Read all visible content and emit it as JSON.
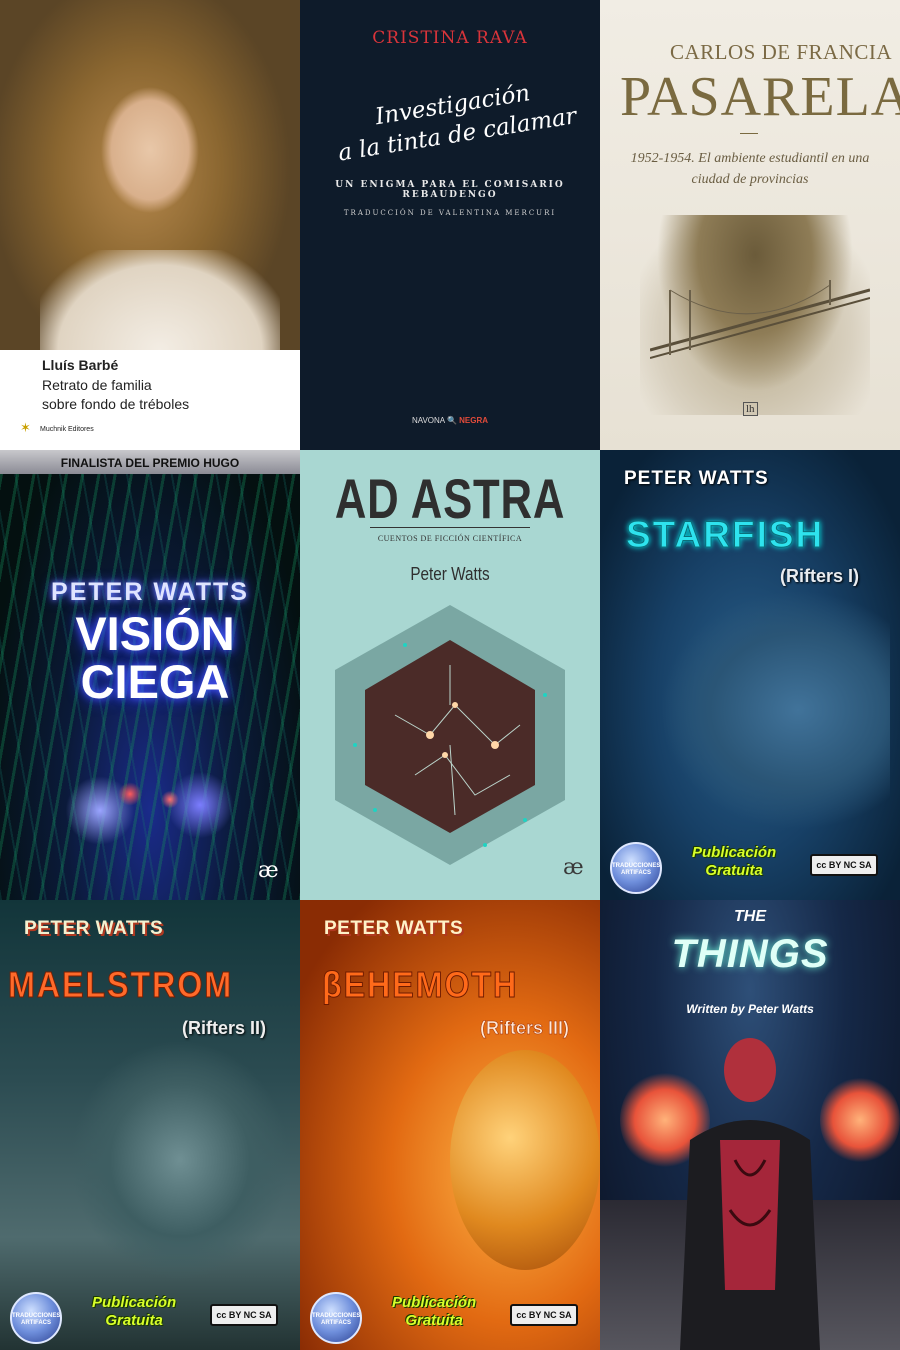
{
  "covers": [
    {
      "author": "Lluís Barbé",
      "title_line1": "Retrato de familia",
      "title_line2": "sobre fondo de tréboles",
      "publisher": "Muchnik Editores"
    },
    {
      "author": "CRISTINA RAVA",
      "title_line1": "Investigación",
      "title_line2": "a la tinta de calamar",
      "subtitle": "UN ENIGMA PARA EL COMISARIO REBAUDENGO",
      "translator": "TRADUCCIÓN DE VALENTINA MERCURI",
      "publisher_a": "NAVONA",
      "publisher_b": "NEGRA"
    },
    {
      "author": "CARLOS DE FRANCIA",
      "title": "PASARELA",
      "subtitle": "1952-1954. El ambiente estudiantil en una ciudad de provincias",
      "publisher": "lh"
    },
    {
      "banner": "FINALISTA DEL PREMIO HUGO",
      "author": "PETER WATTS",
      "title_line1": "VISIÓN",
      "title_line2": "CIEGA"
    },
    {
      "title": "AD ASTRA",
      "subtitle": "CUENTOS DE FICCIÓN CIENTÍFICA",
      "author": "Peter Watts"
    },
    {
      "author": "PETER WATTS",
      "title": "STARFISH",
      "series": "(Rifters I)",
      "badge_line1": "Publicación",
      "badge_line2": "Gratuita"
    },
    {
      "author": "PETER WATTS",
      "title": "MAELSTROM",
      "series": "(Rifters II)",
      "badge_line1": "Publicación",
      "badge_line2": "Gratuita"
    },
    {
      "author": "PETER WATTS",
      "title": "βEHEMOTH",
      "series": "(Rifters III)",
      "badge_line1": "Publicación",
      "badge_line2": "Gratuita"
    },
    {
      "title_the": "THE",
      "title": "THINGS",
      "byline": "Written by Peter Watts"
    }
  ],
  "traducciones_logo": "TRADUCCIONES ARTIFACS",
  "cc_label": "cc BY NC SA",
  "ae_logo": "æ",
  "icons": {
    "publisher_star": "star-icon",
    "search": "magnifier-icon"
  },
  "colors": {
    "rava_red": "#d9343a",
    "starfish_cyan": "#2ee3ee",
    "publicacion_yellow": "#d8ff2a",
    "things_mint": "#dffff7"
  }
}
